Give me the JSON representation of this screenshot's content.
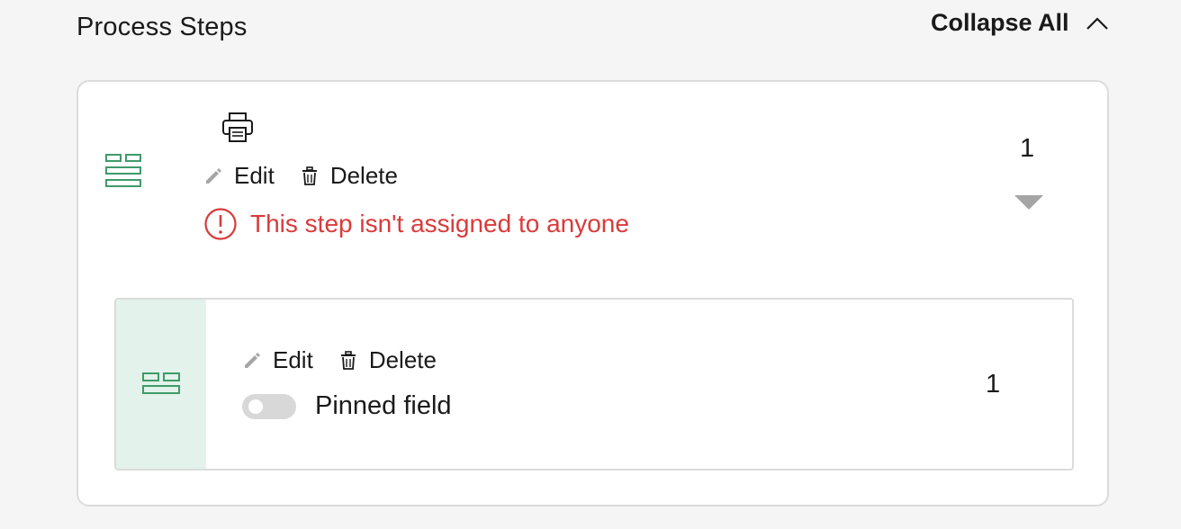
{
  "header": {
    "title": "Process Steps",
    "collapse_all_label": "Collapse All",
    "collapse_icon": "chevron-up-icon"
  },
  "step": {
    "print_icon": "printer-icon",
    "drag_icon": "drag-handle-icon",
    "edit_label": "Edit",
    "delete_label": "Delete",
    "warning_text": "This step isn't assigned to anyone",
    "number": "1",
    "expand_icon": "caret-down-icon",
    "field": {
      "drag_icon": "drag-handle-icon",
      "edit_label": "Edit",
      "delete_label": "Delete",
      "pinned_label": "Pinned field",
      "pinned_on": false,
      "number": "1"
    }
  },
  "colors": {
    "accent_green": "#3f9a6a",
    "handle_bg": "#e3f2ea",
    "warning_red": "#d93b3b",
    "icon_gray": "#a5a5a5",
    "toggle_off": "#d8d8d8"
  }
}
